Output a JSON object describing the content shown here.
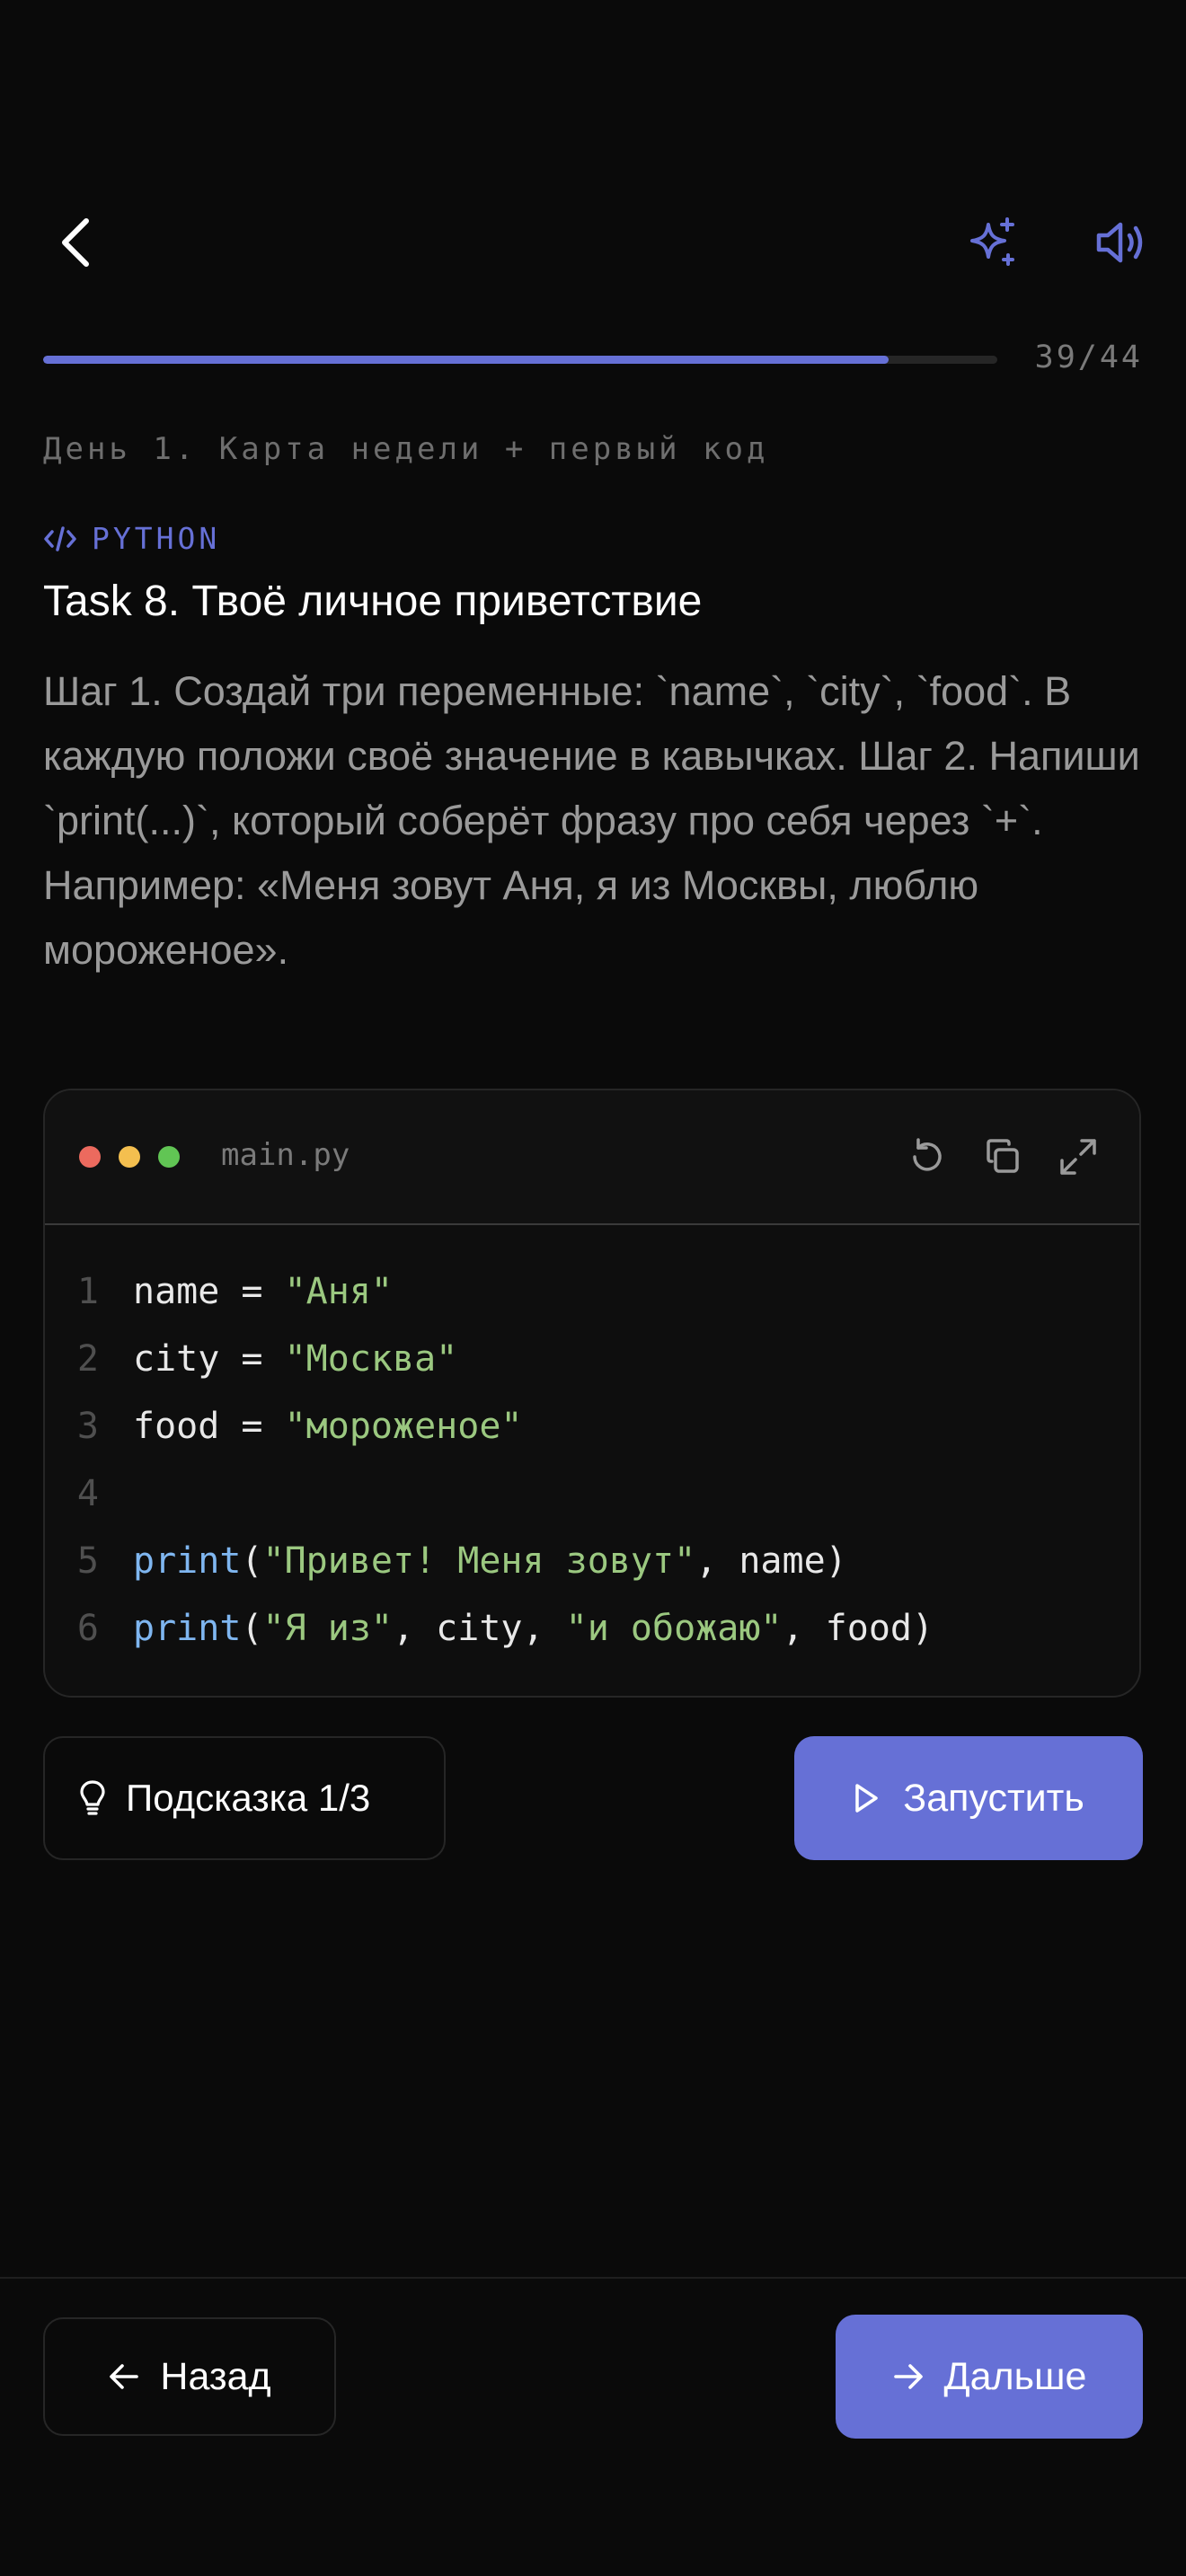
{
  "progress": {
    "current": 39,
    "total": 44,
    "fraction": 0.886,
    "label": "39/44"
  },
  "lesson": {
    "day_label": "День 1. Карта недели + первый код",
    "language": "PYTHON",
    "title": "Task 8. Твоё личное приветствие",
    "description": "Шаг 1. Создай три переменные: `name`, `city`, `food`. В каждую положи своё значение в кавычках. Шаг 2. Напиши `print(...)`, который соберёт фразу про себя через `+`. Например: «Меня зовут Аня, я из Москвы, люблю мороженое»."
  },
  "editor": {
    "filename": "main.py",
    "window_dot_colors": [
      "#ec6a5e",
      "#f4bf4f",
      "#61c554"
    ],
    "lines": [
      {
        "number": "1",
        "tokens": [
          {
            "text": "name = ",
            "kind": "id"
          },
          {
            "text": "\"Аня\"",
            "kind": "str"
          }
        ]
      },
      {
        "number": "2",
        "tokens": [
          {
            "text": "city = ",
            "kind": "id"
          },
          {
            "text": "\"Москва\"",
            "kind": "str"
          }
        ]
      },
      {
        "number": "3",
        "tokens": [
          {
            "text": "food = ",
            "kind": "id"
          },
          {
            "text": "\"мороженое\"",
            "kind": "str"
          }
        ]
      },
      {
        "number": "4",
        "tokens": []
      },
      {
        "number": "5",
        "tokens": [
          {
            "text": "print",
            "kind": "fn"
          },
          {
            "text": "(",
            "kind": "id"
          },
          {
            "text": "\"Привет! Меня зовут\"",
            "kind": "str"
          },
          {
            "text": ", name)",
            "kind": "id"
          }
        ]
      },
      {
        "number": "6",
        "tokens": [
          {
            "text": "print",
            "kind": "fn"
          },
          {
            "text": "(",
            "kind": "id"
          },
          {
            "text": "\"Я из\"",
            "kind": "str"
          },
          {
            "text": ", city, ",
            "kind": "id"
          },
          {
            "text": "\"и обожаю\"",
            "kind": "str"
          },
          {
            "text": ", food)",
            "kind": "id"
          }
        ]
      }
    ]
  },
  "actions": {
    "hint_label": "Подсказка 1/3",
    "run_label": "Запустить"
  },
  "nav": {
    "back_label": "Назад",
    "next_label": "Дальше"
  },
  "colors": {
    "accent": "#6670d6",
    "background": "#0a0a0a",
    "string": "#9bc880",
    "function": "#7fb6f0"
  },
  "icons": {
    "back": "chevron-left-icon",
    "ai": "sparkles-icon",
    "audio": "speaker-icon",
    "language": "code-icon",
    "reset": "reset-icon",
    "copy": "copy-icon",
    "expand": "expand-icon",
    "hint": "lightbulb-icon",
    "run": "play-icon",
    "nav_back": "arrow-left-icon",
    "nav_next": "arrow-right-icon"
  }
}
